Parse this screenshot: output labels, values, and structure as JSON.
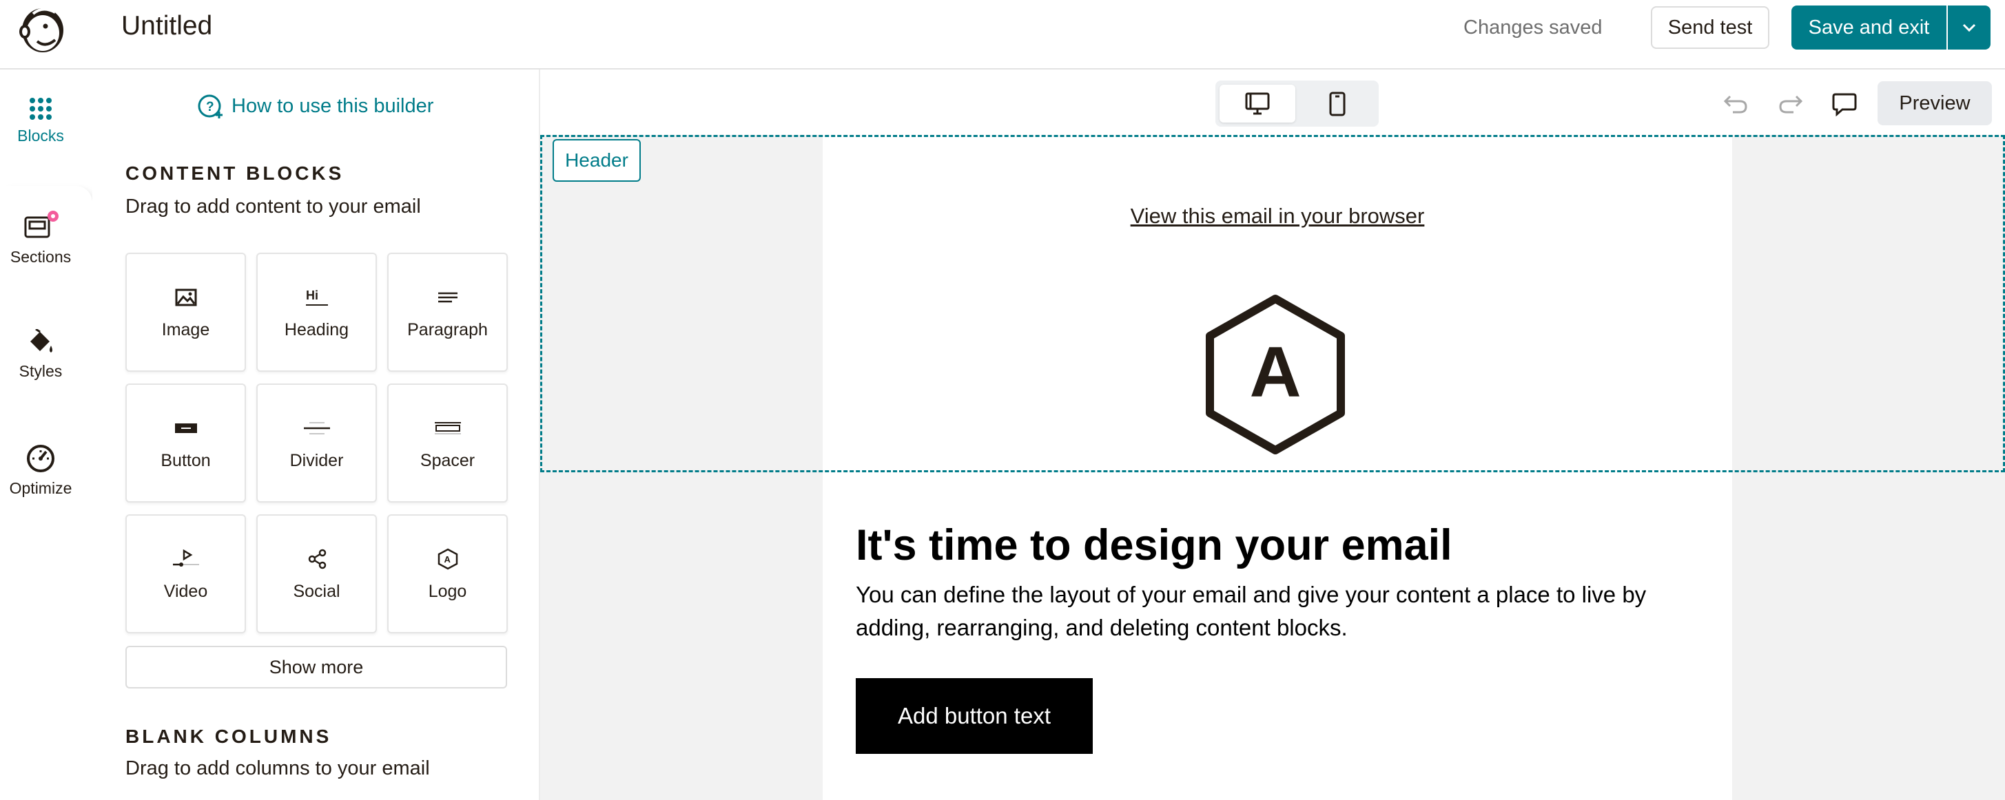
{
  "header": {
    "title": "Untitled",
    "status": "Changes saved",
    "send_test_label": "Send test",
    "save_exit_label": "Save and exit"
  },
  "rail": {
    "items": [
      {
        "label": "Blocks",
        "icon": "grid-icon",
        "active": true
      },
      {
        "label": "Sections",
        "icon": "sections-icon",
        "badge": true
      },
      {
        "label": "Styles",
        "icon": "paint-bucket-icon"
      },
      {
        "label": "Optimize",
        "icon": "gauge-icon"
      }
    ]
  },
  "panel": {
    "help_link": "How to use this builder",
    "content_blocks_title": "CONTENT BLOCKS",
    "content_blocks_sub": "Drag to add content to your email",
    "tiles": [
      {
        "label": "Image",
        "icon": "image-icon"
      },
      {
        "label": "Heading",
        "icon": "heading-icon"
      },
      {
        "label": "Paragraph",
        "icon": "paragraph-icon"
      },
      {
        "label": "Button",
        "icon": "button-icon"
      },
      {
        "label": "Divider",
        "icon": "divider-icon"
      },
      {
        "label": "Spacer",
        "icon": "spacer-icon"
      },
      {
        "label": "Video",
        "icon": "video-icon"
      },
      {
        "label": "Social",
        "icon": "share-icon"
      },
      {
        "label": "Logo",
        "icon": "logo-icon"
      }
    ],
    "show_more_label": "Show more",
    "blank_columns_title": "BLANK COLUMNS",
    "blank_columns_sub": "Drag to add columns to your email"
  },
  "toolbar": {
    "preview_label": "Preview"
  },
  "canvas": {
    "header_tag": "Header",
    "view_in_browser": "View this email in your browser",
    "logo_letter": "A",
    "heading": "It's time to design your email",
    "body": "You can define the layout of your email and give your content a place to live by adding, rearranging, and deleting content blocks.",
    "button_label": "Add button text"
  },
  "colors": {
    "accent": "#007c89",
    "badge": "#f35c9b",
    "canvas_bg": "#f2f2f2"
  }
}
